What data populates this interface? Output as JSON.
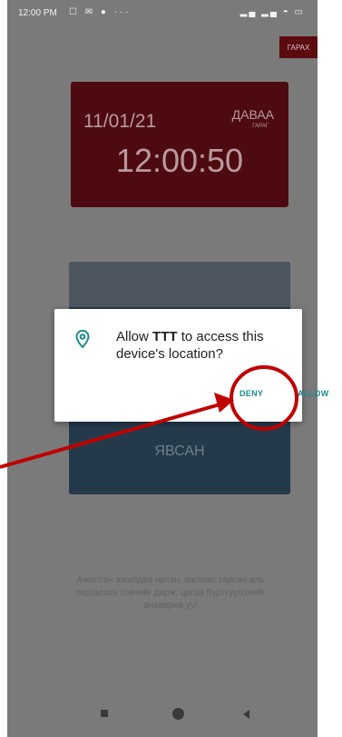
{
  "status_bar": {
    "time": "12:00 PM",
    "notifications": "☐ ✉ ● ···",
    "system": "▂▄ ▂▄ ◓ ▭"
  },
  "header": {
    "garage_label": "ГАРАХ"
  },
  "date_card": {
    "date": "11/01/21",
    "weekday": "ДАВАА",
    "weekday_sub": "ГАРАГ",
    "time": "12:00:50"
  },
  "check_card": {
    "label": "ЯВСАН"
  },
  "hint": "Ажилтан ажилдаа ирсэн, ажлаас тарсан аль харгалзах товчийг дарж, цагаа бүртгүүлэхийг анхаарна уу!",
  "dialog": {
    "prefix": "Allow",
    "app": "TTT",
    "suffix": "to access this device's location?",
    "deny": "DENY",
    "allow": "ALLOW",
    "icon": "location-pin-icon"
  },
  "colors": {
    "overlay": "#7a7a7a",
    "date_card": "#4e0a11",
    "check_card": "#243a4b",
    "accent": "#1f8a8c",
    "annotation": "#c00000"
  }
}
